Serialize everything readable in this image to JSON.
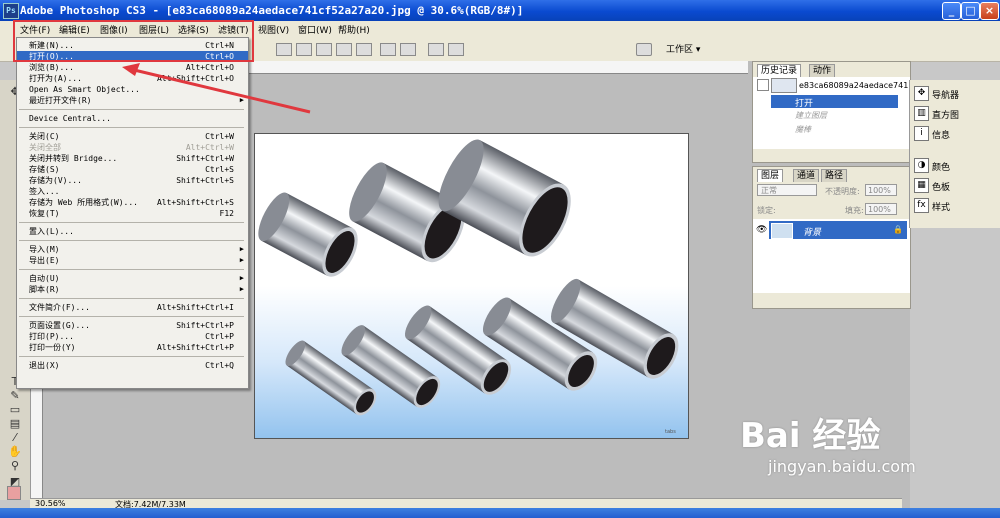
{
  "window": {
    "title": "Adobe Photoshop CS3 - [e83ca68089a24aedace741cf52a27a20.jpg @ 30.6%(RGB/8#)]",
    "app_icon": "Ps",
    "minimize": "_",
    "maximize": "□",
    "close": "×"
  },
  "menubar": {
    "items": [
      "文件(F)",
      "编辑(E)",
      "图像(I)",
      "图层(L)",
      "选择(S)",
      "滤镜(T)",
      "视图(V)",
      "窗口(W)",
      "帮助(H)"
    ]
  },
  "optbar": {
    "workspace": "工作区 ▾"
  },
  "file_menu": {
    "groups": [
      [
        {
          "label": "新建(N)...",
          "shortcut": "Ctrl+N",
          "state": "normal"
        },
        {
          "label": "打开(O)...",
          "shortcut": "Ctrl+O",
          "state": "selected"
        },
        {
          "label": "浏览(B)...",
          "shortcut": "Alt+Ctrl+O",
          "state": "normal"
        },
        {
          "label": "打开为(A)...",
          "shortcut": "Alt+Shift+Ctrl+O",
          "state": "normal"
        },
        {
          "label": "Open As Smart Object...",
          "shortcut": "",
          "state": "normal"
        },
        {
          "label": "最近打开文件(R)",
          "shortcut": "",
          "state": "submenu"
        }
      ],
      [
        {
          "label": "Device Central...",
          "shortcut": "",
          "state": "normal"
        }
      ],
      [
        {
          "label": "关闭(C)",
          "shortcut": "Ctrl+W",
          "state": "normal"
        },
        {
          "label": "关闭全部",
          "shortcut": "Alt+Ctrl+W",
          "state": "disabled"
        },
        {
          "label": "关闭并转到 Bridge...",
          "shortcut": "Shift+Ctrl+W",
          "state": "normal"
        },
        {
          "label": "存储(S)",
          "shortcut": "Ctrl+S",
          "state": "normal"
        },
        {
          "label": "存储为(V)...",
          "shortcut": "Shift+Ctrl+S",
          "state": "normal"
        },
        {
          "label": "签入...",
          "shortcut": "",
          "state": "normal"
        },
        {
          "label": "存储为 Web 所用格式(W)...",
          "shortcut": "Alt+Shift+Ctrl+S",
          "state": "normal"
        },
        {
          "label": "恢复(T)",
          "shortcut": "F12",
          "state": "normal"
        }
      ],
      [
        {
          "label": "置入(L)...",
          "shortcut": "",
          "state": "normal"
        }
      ],
      [
        {
          "label": "导入(M)",
          "shortcut": "",
          "state": "submenu"
        },
        {
          "label": "导出(E)",
          "shortcut": "",
          "state": "submenu"
        }
      ],
      [
        {
          "label": "自动(U)",
          "shortcut": "",
          "state": "submenu"
        },
        {
          "label": "脚本(R)",
          "shortcut": "",
          "state": "submenu"
        }
      ],
      [
        {
          "label": "文件简介(F)...",
          "shortcut": "Alt+Shift+Ctrl+I",
          "state": "normal"
        }
      ],
      [
        {
          "label": "页面设置(G)...",
          "shortcut": "Shift+Ctrl+P",
          "state": "normal"
        },
        {
          "label": "打印(P)...",
          "shortcut": "Ctrl+P",
          "state": "normal"
        },
        {
          "label": "打印一份(Y)",
          "shortcut": "Alt+Shift+Ctrl+P",
          "state": "normal"
        }
      ],
      [
        {
          "label": "退出(X)",
          "shortcut": "Ctrl+Q",
          "state": "normal"
        }
      ]
    ]
  },
  "history_panel": {
    "tabs": [
      "历史记录",
      "动作"
    ],
    "snapshot_label": "e83ca68089a24aedace741...",
    "steps": [
      {
        "label": "打开",
        "state": "current"
      },
      {
        "label": "建立图层",
        "state": "undone"
      },
      {
        "label": "魔棒",
        "state": "undone"
      }
    ]
  },
  "layers_panel": {
    "tabs": [
      "图层",
      "通道",
      "路径"
    ],
    "blend_mode": "正常",
    "opacity_label": "不透明度:",
    "opacity_value": "100%",
    "lock_label": "锁定:",
    "fill_label": "填充:",
    "fill_value": "100%",
    "layer_name": "背景"
  },
  "dock": {
    "items": [
      "导航器",
      "直方图",
      "信息",
      "颜色",
      "色板",
      "样式"
    ]
  },
  "status": {
    "zoom": "30.56%",
    "doc_info": "文档:7.42M/7.33M"
  },
  "image": {
    "credit": "tabs"
  },
  "watermark": {
    "brand": "Bai 经验",
    "url": "jingyan.baidu.com"
  },
  "colors": {
    "highlight_box": "#e0383e",
    "selection": "#316ac5",
    "titlebar": "#0a4ad0"
  }
}
